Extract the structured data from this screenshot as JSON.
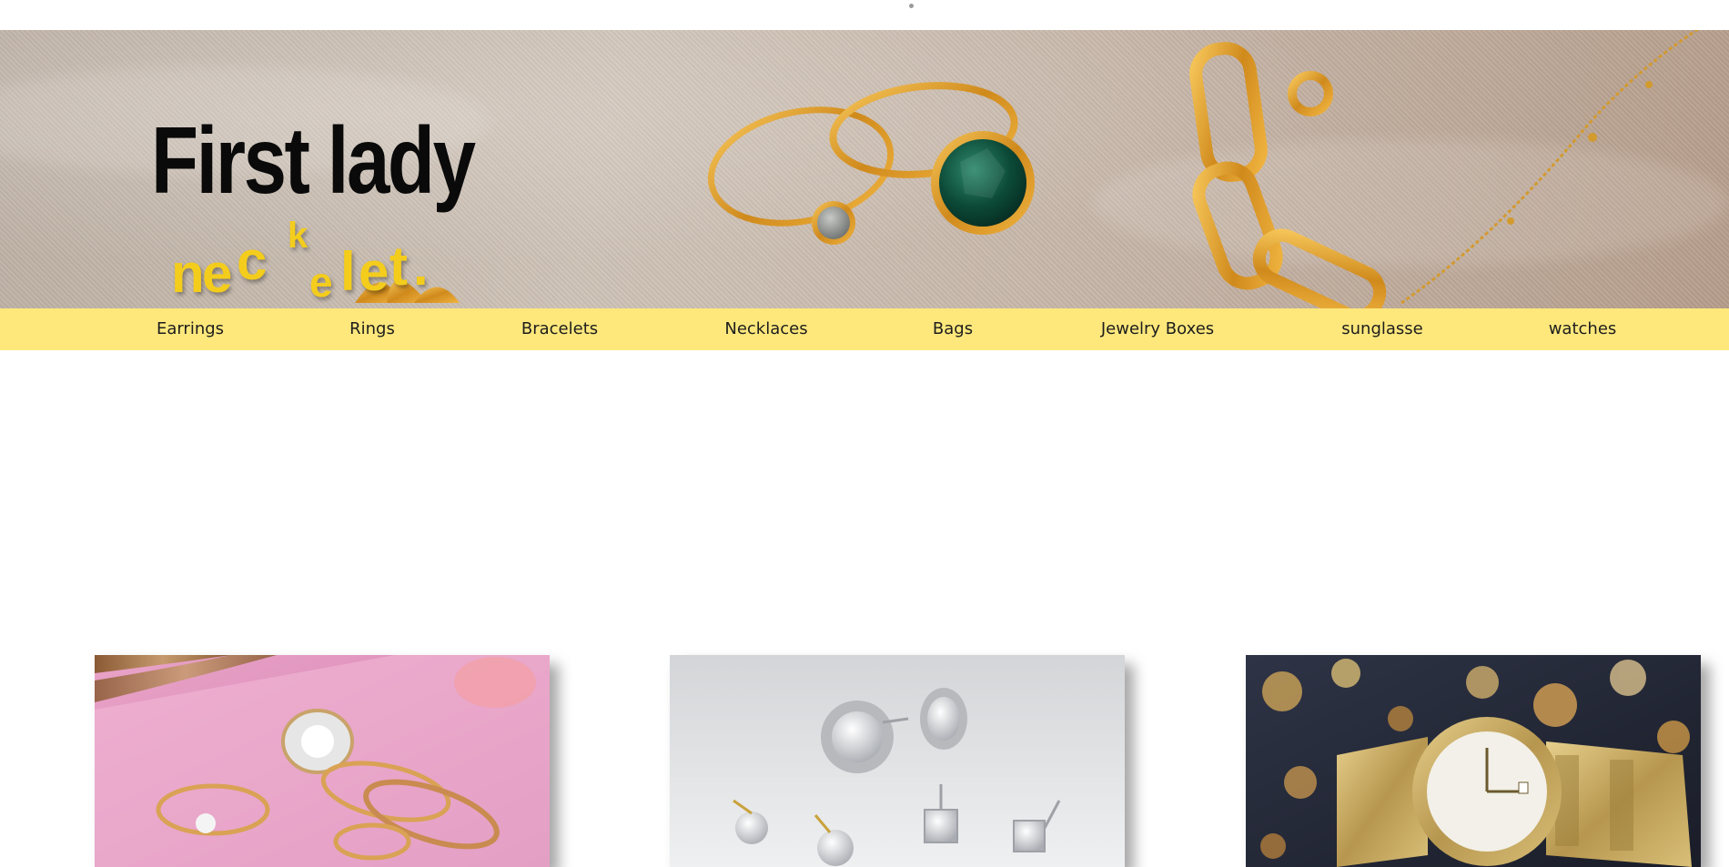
{
  "brand": {
    "title": "First lady",
    "subtitle_letters": [
      "n",
      "e",
      "c",
      "k",
      "e",
      "l",
      "e",
      "t",
      "."
    ]
  },
  "nav": {
    "items": [
      {
        "label": "Earrings"
      },
      {
        "label": "Rings"
      },
      {
        "label": "Bracelets"
      },
      {
        "label": "Necklaces"
      },
      {
        "label": "Bags"
      },
      {
        "label": "Jewelry Boxes"
      },
      {
        "label": "sunglasse"
      },
      {
        "label": "watches"
      }
    ]
  },
  "products": [
    {
      "name": "rings-photo",
      "icon": "rings-image"
    },
    {
      "name": "earrings-photo",
      "icon": "earrings-image"
    },
    {
      "name": "watch-photo",
      "icon": "watch-image"
    }
  ],
  "colors": {
    "nav_bg": "#fee87c",
    "subtitle": "#f4cd1c",
    "title": "#0a0a0a",
    "gold": "#d59a2a",
    "emerald": "#0f4a3a"
  }
}
